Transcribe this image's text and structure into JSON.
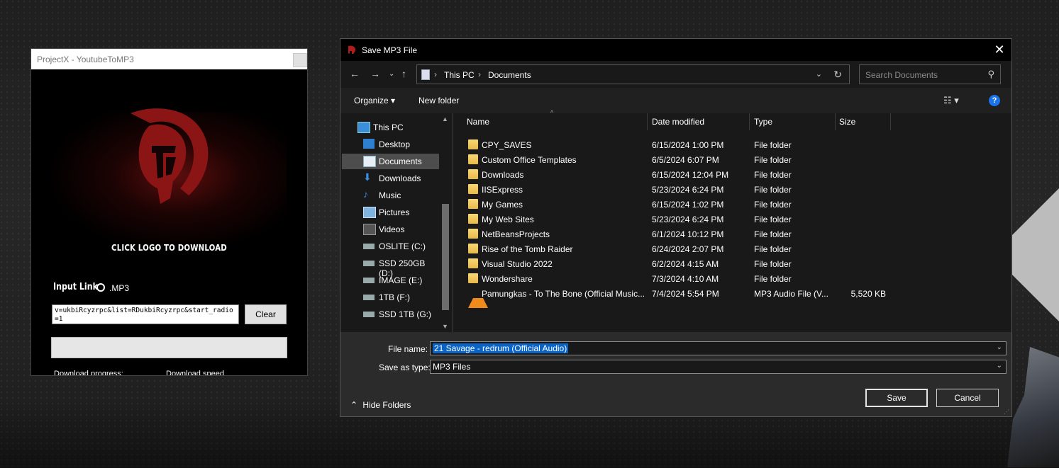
{
  "projectx": {
    "title": "ProjectX - YoutubeToMP3",
    "cta": "CLICK LOGO TO DOWNLOAD",
    "input_label": "Input Link",
    "format_option": ".MP3",
    "link_value": "v=ukbiRcyzrpc&list=RDukbiRcyzrpc&start_radio=1",
    "clear_label": "Clear",
    "progress": 0,
    "download_progress_label": "Download progress:",
    "download_speed_label": "Download speed",
    "accent": "#8b1414"
  },
  "dialog": {
    "title": "Save MP3 File",
    "close_glyph": "✕",
    "breadcrumb": [
      "This PC",
      "Documents"
    ],
    "search_placeholder": "Search Documents",
    "organize_label": "Organize ▾",
    "new_folder_label": "New folder",
    "help_glyph": "?",
    "nav_items": [
      {
        "label": "This PC",
        "icon": "computer-icon"
      },
      {
        "label": "Desktop",
        "icon": "desktop-icon"
      },
      {
        "label": "Documents",
        "icon": "documents-icon",
        "selected": true
      },
      {
        "label": "Downloads",
        "icon": "downloads-icon"
      },
      {
        "label": "Music",
        "icon": "music-icon"
      },
      {
        "label": "Pictures",
        "icon": "pictures-icon"
      },
      {
        "label": "Videos",
        "icon": "videos-icon"
      },
      {
        "label": "OSLITE  (C:)",
        "icon": "drive-icon"
      },
      {
        "label": "SSD 250GB (D:)",
        "icon": "drive-icon"
      },
      {
        "label": "IMAGE (E:)",
        "icon": "drive-icon"
      },
      {
        "label": "1TB (F:)",
        "icon": "drive-icon"
      },
      {
        "label": "SSD 1TB (G:)",
        "icon": "drive-icon"
      }
    ],
    "columns": {
      "name": "Name",
      "date": "Date modified",
      "type": "Type",
      "size": "Size"
    },
    "files": [
      {
        "name": "CPY_SAVES",
        "date": "6/15/2024 1:00 PM",
        "type": "File folder",
        "size": ""
      },
      {
        "name": "Custom Office Templates",
        "date": "6/5/2024 6:07 PM",
        "type": "File folder",
        "size": ""
      },
      {
        "name": "Downloads",
        "date": "6/15/2024 12:04 PM",
        "type": "File folder",
        "size": ""
      },
      {
        "name": "IISExpress",
        "date": "5/23/2024 6:24 PM",
        "type": "File folder",
        "size": ""
      },
      {
        "name": "My Games",
        "date": "6/15/2024 1:02 PM",
        "type": "File folder",
        "size": ""
      },
      {
        "name": "My Web Sites",
        "date": "5/23/2024 6:24 PM",
        "type": "File folder",
        "size": ""
      },
      {
        "name": "NetBeansProjects",
        "date": "6/1/2024 10:12 PM",
        "type": "File folder",
        "size": ""
      },
      {
        "name": "Rise of the Tomb Raider",
        "date": "6/24/2024 2:07 PM",
        "type": "File folder",
        "size": ""
      },
      {
        "name": "Visual Studio 2022",
        "date": "6/2/2024 4:15 AM",
        "type": "File folder",
        "size": ""
      },
      {
        "name": "Wondershare",
        "date": "7/3/2024 4:10 AM",
        "type": "File folder",
        "size": ""
      },
      {
        "name": "Pamungkas - To The Bone (Official Music...",
        "date": "7/4/2024 5:54 PM",
        "type": "MP3 Audio File (V...",
        "size": "5,520 KB",
        "icon": "vlc-icon"
      }
    ],
    "file_name_label": "File name:",
    "file_name_value": "21 Savage - redrum (Official Audio)",
    "save_type_label": "Save as type:",
    "save_type_value": "MP3 Files",
    "save_label": "Save",
    "cancel_label": "Cancel",
    "hide_folders_label": "Hide Folders"
  }
}
